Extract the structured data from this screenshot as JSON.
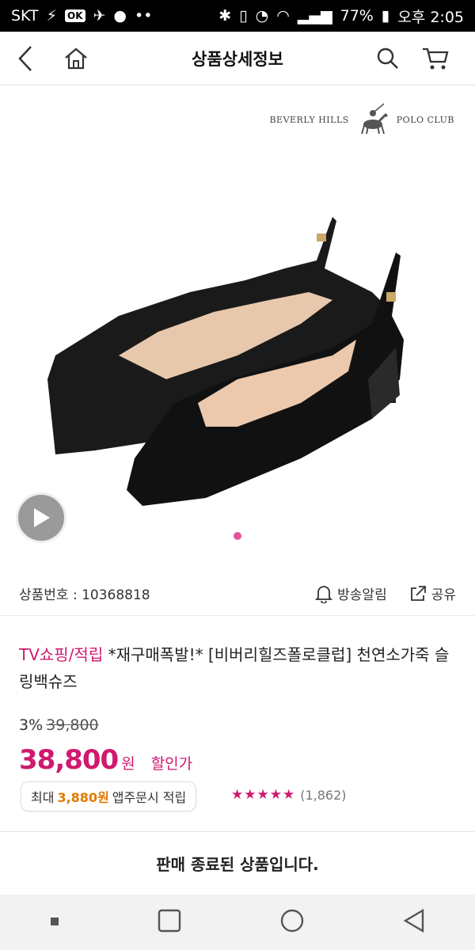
{
  "status": {
    "carrier": "SKT",
    "battery": "77%",
    "time": "오후 2:05",
    "ok_badge": "OK"
  },
  "header": {
    "title": "상품상세정보"
  },
  "brand": {
    "left": "BEVERLY HILLS",
    "right": "POLO CLUB"
  },
  "info": {
    "product_number": "상품번호 : 10368818",
    "notify_label": "방송알림",
    "share_label": "공유"
  },
  "product": {
    "category": "TV쇼핑/적립",
    "name": " *재구매폭발!* [비버리힐즈폴로클럽] 천연소가죽 슬링백슈즈",
    "discount_rate": "3%",
    "original_price": "39,800",
    "price": "38,800",
    "currency": "원",
    "price_label": "할인가",
    "points_prefix": "최대",
    "points_value": "3,880원",
    "points_suffix": "앱주문시 적립",
    "rating_stars": "★★★★★",
    "review_count": "(1,862)",
    "rating": 4.5
  },
  "notice": "판매 종료된 상품입니다.",
  "colors": {
    "accent": "#d0196f",
    "points": "#e27a00",
    "indicator": "#e8539a"
  }
}
